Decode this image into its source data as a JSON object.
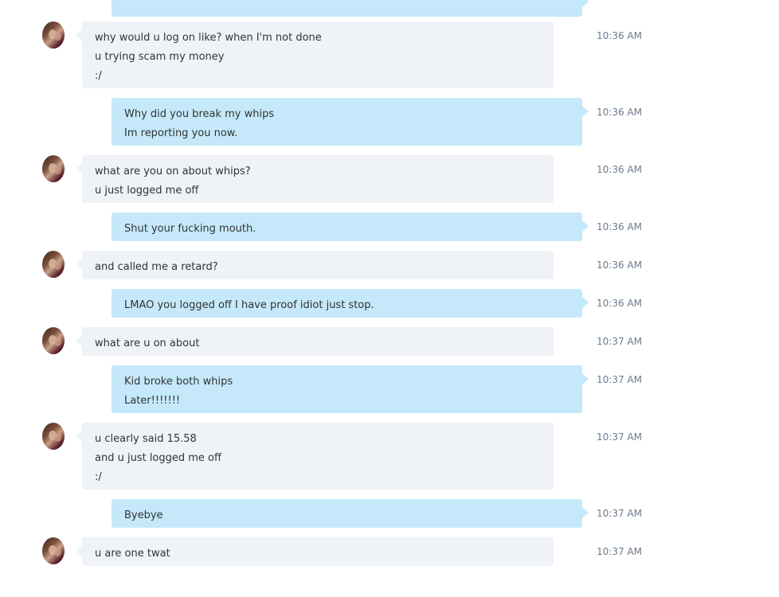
{
  "messages": [
    {
      "dir": "out",
      "lines": [
        ""
      ],
      "time": ""
    },
    {
      "dir": "in",
      "lines": [
        "why would u log on like? when I'm not done",
        "u trying scam my money",
        ":/"
      ],
      "time": "10:36 AM"
    },
    {
      "dir": "out",
      "lines": [
        "Why did you break my whips",
        "Im reporting you now."
      ],
      "time": "10:36 AM"
    },
    {
      "dir": "in",
      "lines": [
        "what are you on about whips?",
        "u just logged me off"
      ],
      "time": "10:36 AM"
    },
    {
      "dir": "out",
      "lines": [
        "Shut your fucking mouth."
      ],
      "time": "10:36 AM"
    },
    {
      "dir": "in",
      "lines": [
        "and called me a retard?"
      ],
      "time": "10:36 AM"
    },
    {
      "dir": "out",
      "lines": [
        "LMAO you logged off I have proof idiot just stop."
      ],
      "time": "10:36 AM"
    },
    {
      "dir": "in",
      "lines": [
        "what are u on about"
      ],
      "time": "10:37 AM"
    },
    {
      "dir": "out",
      "lines": [
        "Kid broke both whips",
        "Later!!!!!!!"
      ],
      "time": "10:37 AM"
    },
    {
      "dir": "in",
      "lines": [
        "u clearly said 15.58",
        "and u just logged me off",
        ":/"
      ],
      "time": "10:37 AM"
    },
    {
      "dir": "out",
      "lines": [
        "Byebye"
      ],
      "time": "10:37 AM"
    },
    {
      "dir": "in",
      "lines": [
        "u are one twat"
      ],
      "time": "10:37 AM"
    }
  ],
  "colors": {
    "incoming_bubble": "#eff2f6",
    "outgoing_bubble": "#c5e9fa",
    "timestamp": "#6b7b8c",
    "text": "#333333"
  },
  "icons": {
    "avatar": "contact-avatar-photo"
  }
}
